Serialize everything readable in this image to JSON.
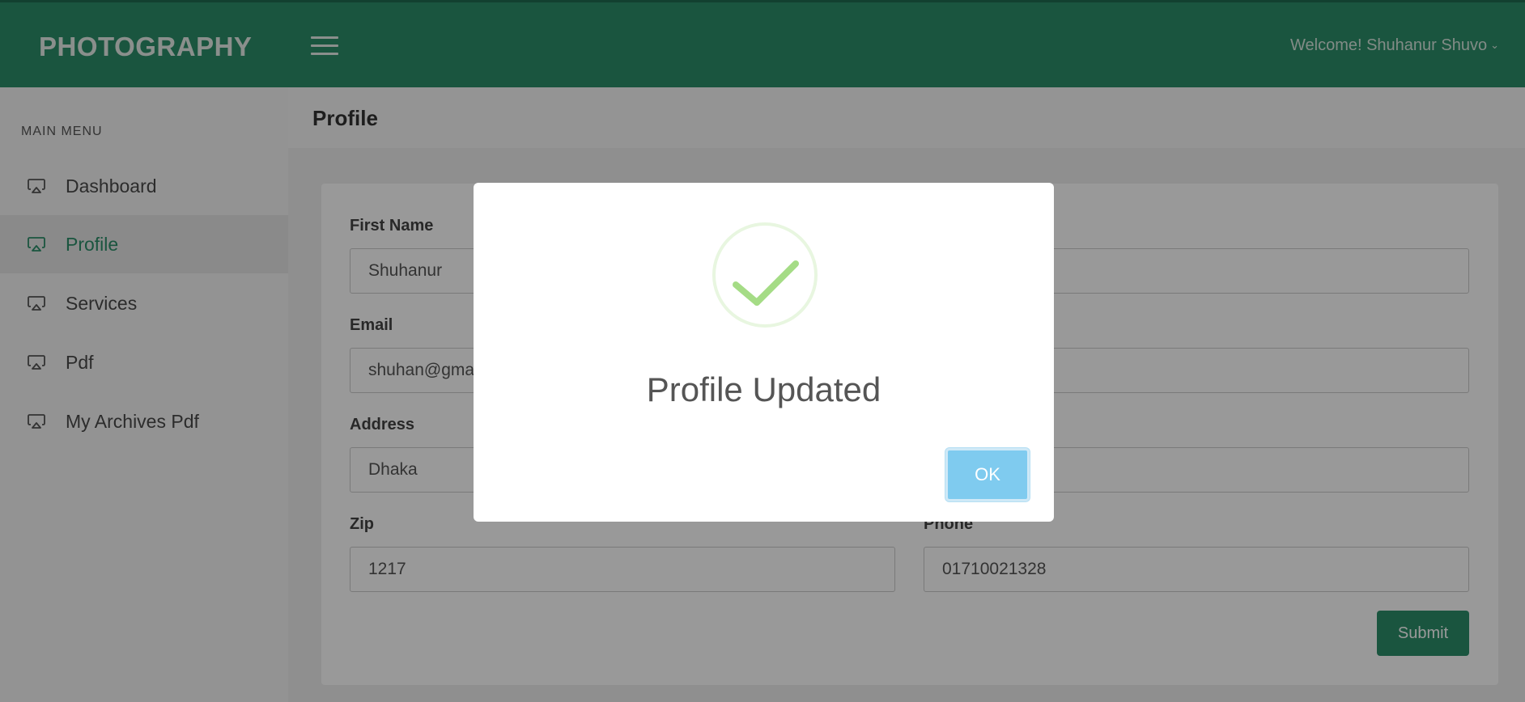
{
  "header": {
    "brand": "PHOTOGRAPHY",
    "welcome": "Welcome! Shuhanur Shuvo",
    "menu_icon": "hamburger-menu-icon",
    "chevron_icon": "chevron-down-icon"
  },
  "sidebar": {
    "heading": "MAIN MENU",
    "items": [
      {
        "label": "Dashboard",
        "icon": "airplay-icon",
        "active": false
      },
      {
        "label": "Profile",
        "icon": "airplay-icon",
        "active": true
      },
      {
        "label": "Services",
        "icon": "airplay-icon",
        "active": false
      },
      {
        "label": "Pdf",
        "icon": "airplay-icon",
        "active": false
      },
      {
        "label": "My Archives Pdf",
        "icon": "airplay-icon",
        "active": false
      }
    ]
  },
  "page": {
    "title": "Profile"
  },
  "form": {
    "first_name_label": "First Name",
    "first_name_value": "Shuhanur",
    "email_label": "Email",
    "email_value": "shuhan@gma",
    "address_label": "Address",
    "address_value": "Dhaka",
    "zip_label": "Zip",
    "zip_value": "1217",
    "phone_label": "Phone",
    "phone_value": "01710021328",
    "submit_label": "Submit"
  },
  "modal": {
    "title": "Profile Updated",
    "ok_label": "OK",
    "icon": "success-check-icon"
  },
  "colors": {
    "brand_green": "#2c8e69",
    "ok_blue": "#7fcbef",
    "check_green": "#a5dc86"
  }
}
